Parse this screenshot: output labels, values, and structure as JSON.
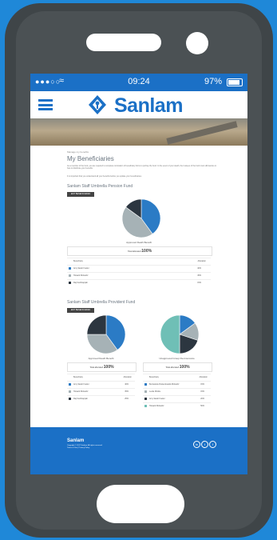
{
  "status_bar": {
    "signal": "●●●○○",
    "time": "09:24",
    "battery": "97%"
  },
  "brand": {
    "name": "Sanlam",
    "color": "#1b70c6"
  },
  "page": {
    "breadcrumb": "Manage my benefits",
    "title": "My Beneficiaries",
    "intro": "As a member of the fund, you are required to complete nomination of beneficiary forms to portray the fund. In the event of your death, the trustees of the fund must still decide on how to distribute your benefits.",
    "intro2": "It is important that you understand all your benefits before you update your beneficiaries."
  },
  "funds": [
    {
      "title": "Sanlam Staff Umbrella Pension Fund",
      "button": "EDIT BENEFICIARIES",
      "chart_caption": "Approved Death Benefit",
      "total_label": "Total allocated",
      "total_value": "100%",
      "col_beneficiary": "Beneficiary",
      "col_allocation": "Allocation",
      "rows": [
        {
          "name": "Amy Sarah Fowler",
          "allocation": "40%",
          "color": "#2b7bc5"
        },
        {
          "name": "Howard Wolowitz",
          "allocation": "45%",
          "color": "#a6b2b6"
        },
        {
          "name": "Raj Koothrappali",
          "allocation": "15%",
          "color": "#2c3640"
        }
      ]
    },
    {
      "title": "Sanlam Staff Umbrella Provident Fund",
      "button": "EDIT BENEFICIARIES",
      "chart_caption": "Approved Death Benefit",
      "total_label": "Total allocated",
      "total_value": "100%",
      "col_beneficiary": "Beneficiary",
      "col_allocation": "Allocation",
      "rows": [
        {
          "name": "Amy Sarah Fowler",
          "allocation": "40%",
          "color": "#2b7bc5"
        },
        {
          "name": "Howard Wolowitz",
          "allocation": "35%",
          "color": "#a6b2b6"
        },
        {
          "name": "Raj Koothrappali",
          "allocation": "25%",
          "color": "#2c3640"
        }
      ],
      "chart2_caption": "Unapproved Group Re-Insurance",
      "rows2": [
        {
          "name": "Bernadette Rostenkowski-Wolowitz",
          "allocation": "15%",
          "color": "#2b7bc5"
        },
        {
          "name": "Leslie Winkle",
          "allocation": "15%",
          "color": "#a6b2b6"
        },
        {
          "name": "Amy Sarah Fowler",
          "allocation": "20%",
          "color": "#2c3640"
        },
        {
          "name": "Howard Wolowitz",
          "allocation": "50%",
          "color": "#6fbfb6"
        }
      ]
    }
  ],
  "footer": {
    "logo": "Sanlam",
    "copyright": "Copyright © 2017 Sanlam. All rights reserved.",
    "links": "Terms of Use | Privacy Policy",
    "social": [
      "in",
      "t",
      "f"
    ]
  },
  "chart_data": [
    {
      "type": "pie",
      "title": "Approved Death Benefit",
      "categories": [
        "Amy Sarah Fowler",
        "Howard Wolowitz",
        "Raj Koothrappali"
      ],
      "values": [
        40,
        45,
        15
      ]
    },
    {
      "type": "pie",
      "title": "Approved Death Benefit",
      "categories": [
        "Amy Sarah Fowler",
        "Howard Wolowitz",
        "Raj Koothrappali"
      ],
      "values": [
        40,
        35,
        25
      ]
    },
    {
      "type": "pie",
      "title": "Unapproved Group Re-Insurance",
      "categories": [
        "Bernadette Rostenkowski-Wolowitz",
        "Leslie Winkle",
        "Amy Sarah Fowler",
        "Howard Wolowitz"
      ],
      "values": [
        15,
        15,
        20,
        50
      ]
    }
  ]
}
